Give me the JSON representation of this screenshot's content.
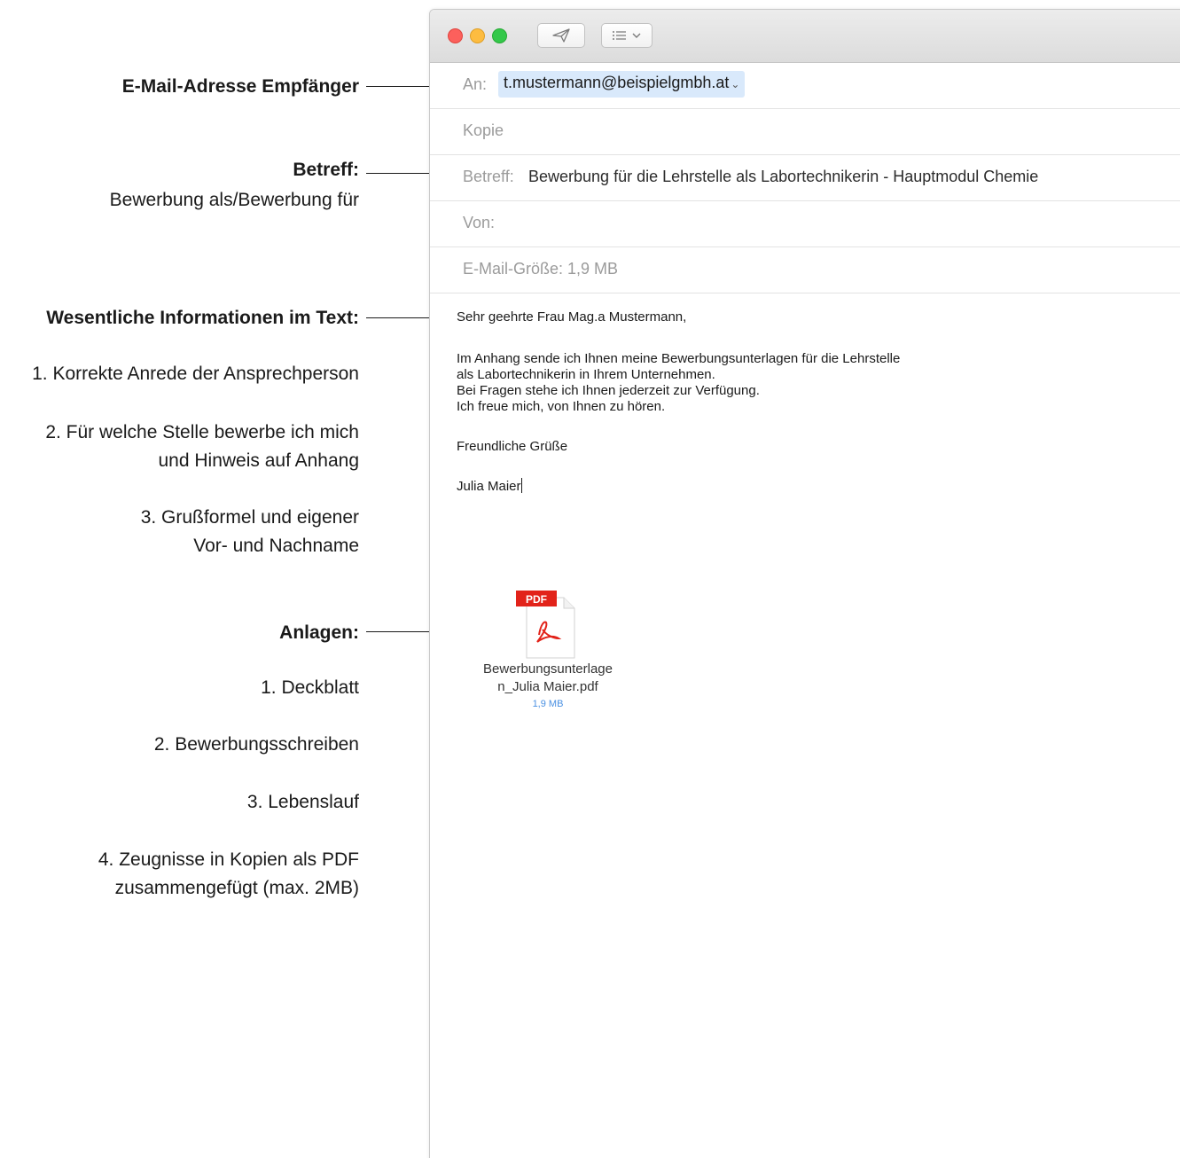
{
  "annotations": {
    "recipient_title": "E-Mail-Adresse Empfänger",
    "subject_title": "Betreff:",
    "subject_sub": "Bewerbung als/Bewerbung für",
    "info_title": "Wesentliche Informationen im Text:",
    "info_items": [
      "1. Korrekte Anrede der Ansprechperson",
      "2. Für welche Stelle bewerbe ich mich",
      "und Hinweis auf Anhang",
      "3. Grußformel und eigener",
      "Vor- und Nachname"
    ],
    "attachments_title": "Anlagen:",
    "attachment_items": [
      "1. Deckblatt",
      "2. Bewerbungsschreiben",
      "3. Lebenslauf",
      "4. Zeugnisse in Kopien als PDF",
      "zusammengefügt (max. 2MB)"
    ]
  },
  "mail": {
    "to_label": "An:",
    "to_value": "t.mustermann@beispielgmbh.at",
    "cc_label": "Kopie",
    "subject_label": "Betreff:",
    "subject_value": "Bewerbung für die Lehrstelle als Labortechnikerin - Hauptmodul Chemie",
    "from_label": "Von:",
    "size_label": "E-Mail-Größe: 1,9 MB",
    "body": {
      "salutation": "Sehr geehrte Frau Mag.a Mustermann,",
      "lines": [
        "Im Anhang sende ich Ihnen meine Bewerbungsunterlagen für die Lehrstelle",
        "als Labortechnikerin in Ihrem Unternehmen.",
        "Bei Fragen stehe ich Ihnen jederzeit zur Verfügung.",
        "Ich freue mich, von Ihnen zu hören."
      ],
      "closing": "Freundliche Grüße",
      "signature": "Julia Maier"
    },
    "attachment": {
      "icon_label": "PDF",
      "name_line1": "Bewerbungsunterlage",
      "name_line2": "n_Julia Maier.pdf",
      "size": "1,9 MB"
    }
  },
  "colors": {
    "close": "#fc605c",
    "minimize": "#fdbc40",
    "zoom": "#34c84a",
    "chip": "#d9e9fb",
    "pdf_red": "#e2231a",
    "link_blue": "#4a90e2"
  }
}
